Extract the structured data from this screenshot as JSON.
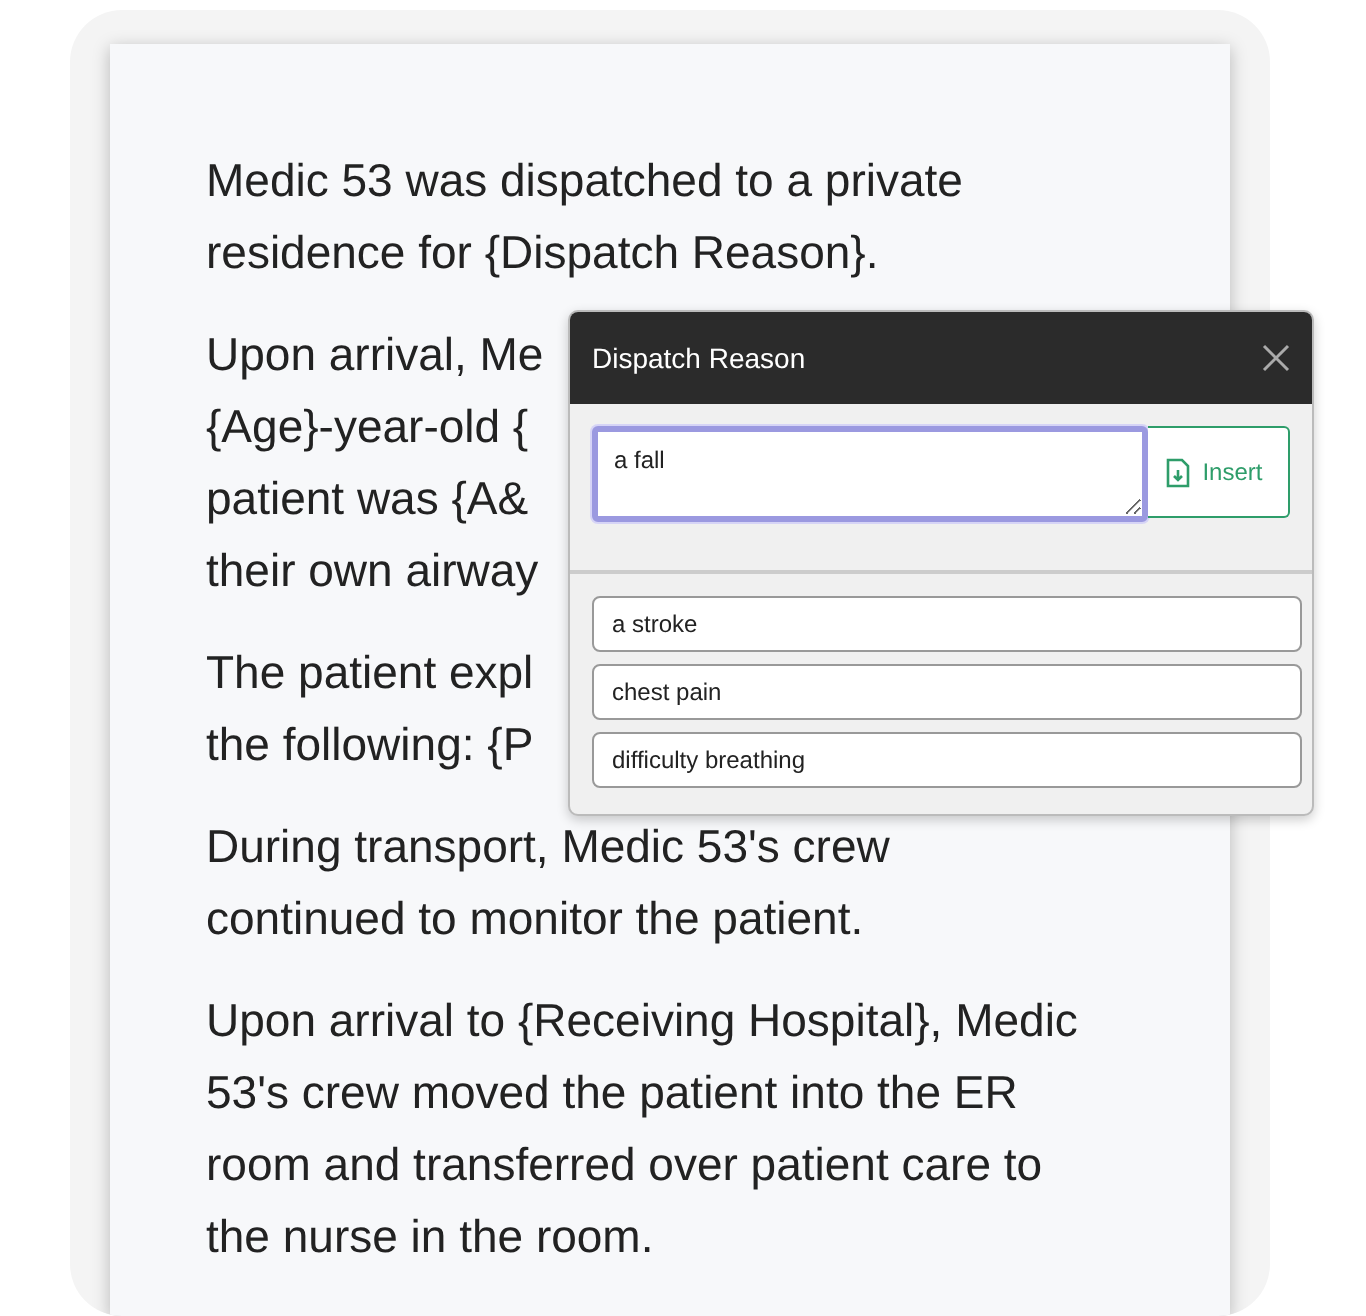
{
  "paragraphs": [
    {
      "kind": "text",
      "text": "Medic 53 was dispatched to a private\nresidence for {Dispatch Reason}."
    },
    {
      "kind": "lines",
      "lines": [
        "Upon arrival, Me",
        "{Age}-year-old {",
        "patient was {A&",
        "their own airway"
      ]
    },
    {
      "kind": "lines",
      "lines": [
        "The patient expl",
        "the following: {P"
      ]
    },
    {
      "kind": "text",
      "text": "During transport, Medic 53's crew\ncontinued to monitor the patient."
    },
    {
      "kind": "text",
      "text": "Upon arrival to {Receiving Hospital}, Medic\n53's crew moved the patient into the ER\nroom and transferred over patient care to\nthe nurse in the room."
    }
  ],
  "popup": {
    "title": "Dispatch Reason",
    "value": "a fall",
    "focused": true,
    "insert_button": "Insert",
    "options": [
      "a stroke",
      "chest pain",
      "difficulty breathing"
    ]
  }
}
